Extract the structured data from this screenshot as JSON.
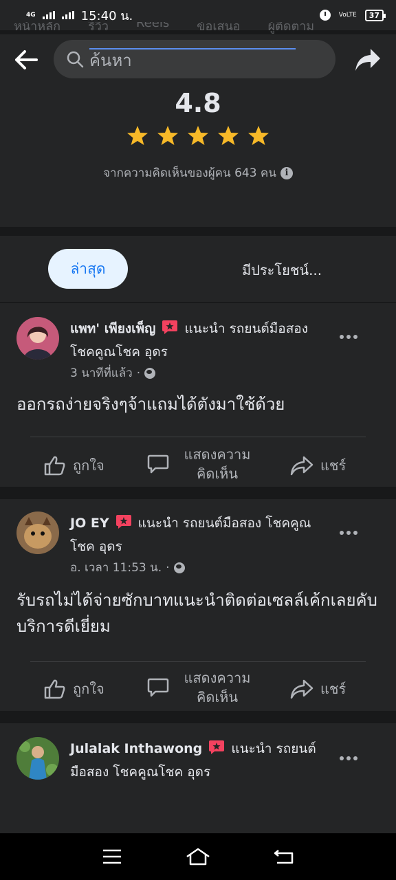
{
  "status_bar": {
    "network": "4G",
    "time": "15:40 น.",
    "volte": "VoLTE",
    "battery": "37"
  },
  "header": {
    "ghost_tabs": [
      "หน้าหลัก",
      "รีวิว",
      "Reels",
      "ข้อเสนอ",
      "ผู้ติดตาม"
    ],
    "search_placeholder": "ค้นหา"
  },
  "rating": {
    "value": "4.8",
    "stars": 5,
    "caption": "จากความคิดเห็นของผู้คน 643 คน"
  },
  "filters": {
    "active": "ล่าสุด",
    "other": "มีประโยชน์..."
  },
  "posts": [
    {
      "name": "แพท' เพียงเพ็ญ",
      "rec_text": "แนะนำ รถยนต์มือสอง โชคคูณโชค อุดร",
      "time": "3 นาทีที่แล้ว",
      "body": "ออกรถง่ายจริงๆจ้าแถมได้ตังมาใช้ด้วย",
      "avatar_color": "#c65a7a"
    },
    {
      "name": "JO EY",
      "rec_text": "แนะนำ รถยนต์มือสอง โชคคูณโชค อุดร",
      "time": "อ. เวลา 11:53 น.",
      "body": "รับรถไม่ได้จ่ายซักบาทแนะนำติดต่อเซลล์เค้กเลยคับ บริการดีเยี่ยม",
      "avatar_color": "#8a6a4a"
    },
    {
      "name": "Julalak Inthawong",
      "rec_text": "แนะนำ รถยนต์มือสอง โชคคูณโชค อุดร",
      "avatar_color": "#4f7d3a"
    }
  ],
  "actions": {
    "like": "ถูกใจ",
    "comment_line1": "แสดงความ",
    "comment_line2": "คิดเห็น",
    "share": "แชร์"
  },
  "colors": {
    "background": "#18191a",
    "surface": "#242526",
    "star": "#f7b928",
    "accent": "#1877f2",
    "recommend": "#f3425f"
  }
}
